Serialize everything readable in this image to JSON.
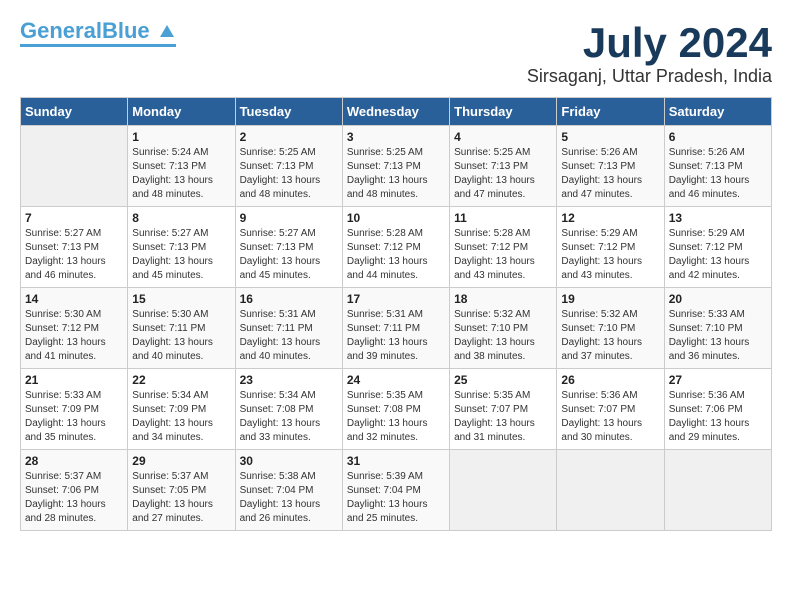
{
  "header": {
    "logo_general": "General",
    "logo_blue": "Blue",
    "month_title": "July 2024",
    "location": "Sirsaganj, Uttar Pradesh, India"
  },
  "calendar": {
    "days_of_week": [
      "Sunday",
      "Monday",
      "Tuesday",
      "Wednesday",
      "Thursday",
      "Friday",
      "Saturday"
    ],
    "weeks": [
      [
        {
          "day": "",
          "info": ""
        },
        {
          "day": "1",
          "info": "Sunrise: 5:24 AM\nSunset: 7:13 PM\nDaylight: 13 hours\nand 48 minutes."
        },
        {
          "day": "2",
          "info": "Sunrise: 5:25 AM\nSunset: 7:13 PM\nDaylight: 13 hours\nand 48 minutes."
        },
        {
          "day": "3",
          "info": "Sunrise: 5:25 AM\nSunset: 7:13 PM\nDaylight: 13 hours\nand 48 minutes."
        },
        {
          "day": "4",
          "info": "Sunrise: 5:25 AM\nSunset: 7:13 PM\nDaylight: 13 hours\nand 47 minutes."
        },
        {
          "day": "5",
          "info": "Sunrise: 5:26 AM\nSunset: 7:13 PM\nDaylight: 13 hours\nand 47 minutes."
        },
        {
          "day": "6",
          "info": "Sunrise: 5:26 AM\nSunset: 7:13 PM\nDaylight: 13 hours\nand 46 minutes."
        }
      ],
      [
        {
          "day": "7",
          "info": "Sunrise: 5:27 AM\nSunset: 7:13 PM\nDaylight: 13 hours\nand 46 minutes."
        },
        {
          "day": "8",
          "info": "Sunrise: 5:27 AM\nSunset: 7:13 PM\nDaylight: 13 hours\nand 45 minutes."
        },
        {
          "day": "9",
          "info": "Sunrise: 5:27 AM\nSunset: 7:13 PM\nDaylight: 13 hours\nand 45 minutes."
        },
        {
          "day": "10",
          "info": "Sunrise: 5:28 AM\nSunset: 7:12 PM\nDaylight: 13 hours\nand 44 minutes."
        },
        {
          "day": "11",
          "info": "Sunrise: 5:28 AM\nSunset: 7:12 PM\nDaylight: 13 hours\nand 43 minutes."
        },
        {
          "day": "12",
          "info": "Sunrise: 5:29 AM\nSunset: 7:12 PM\nDaylight: 13 hours\nand 43 minutes."
        },
        {
          "day": "13",
          "info": "Sunrise: 5:29 AM\nSunset: 7:12 PM\nDaylight: 13 hours\nand 42 minutes."
        }
      ],
      [
        {
          "day": "14",
          "info": "Sunrise: 5:30 AM\nSunset: 7:12 PM\nDaylight: 13 hours\nand 41 minutes."
        },
        {
          "day": "15",
          "info": "Sunrise: 5:30 AM\nSunset: 7:11 PM\nDaylight: 13 hours\nand 40 minutes."
        },
        {
          "day": "16",
          "info": "Sunrise: 5:31 AM\nSunset: 7:11 PM\nDaylight: 13 hours\nand 40 minutes."
        },
        {
          "day": "17",
          "info": "Sunrise: 5:31 AM\nSunset: 7:11 PM\nDaylight: 13 hours\nand 39 minutes."
        },
        {
          "day": "18",
          "info": "Sunrise: 5:32 AM\nSunset: 7:10 PM\nDaylight: 13 hours\nand 38 minutes."
        },
        {
          "day": "19",
          "info": "Sunrise: 5:32 AM\nSunset: 7:10 PM\nDaylight: 13 hours\nand 37 minutes."
        },
        {
          "day": "20",
          "info": "Sunrise: 5:33 AM\nSunset: 7:10 PM\nDaylight: 13 hours\nand 36 minutes."
        }
      ],
      [
        {
          "day": "21",
          "info": "Sunrise: 5:33 AM\nSunset: 7:09 PM\nDaylight: 13 hours\nand 35 minutes."
        },
        {
          "day": "22",
          "info": "Sunrise: 5:34 AM\nSunset: 7:09 PM\nDaylight: 13 hours\nand 34 minutes."
        },
        {
          "day": "23",
          "info": "Sunrise: 5:34 AM\nSunset: 7:08 PM\nDaylight: 13 hours\nand 33 minutes."
        },
        {
          "day": "24",
          "info": "Sunrise: 5:35 AM\nSunset: 7:08 PM\nDaylight: 13 hours\nand 32 minutes."
        },
        {
          "day": "25",
          "info": "Sunrise: 5:35 AM\nSunset: 7:07 PM\nDaylight: 13 hours\nand 31 minutes."
        },
        {
          "day": "26",
          "info": "Sunrise: 5:36 AM\nSunset: 7:07 PM\nDaylight: 13 hours\nand 30 minutes."
        },
        {
          "day": "27",
          "info": "Sunrise: 5:36 AM\nSunset: 7:06 PM\nDaylight: 13 hours\nand 29 minutes."
        }
      ],
      [
        {
          "day": "28",
          "info": "Sunrise: 5:37 AM\nSunset: 7:06 PM\nDaylight: 13 hours\nand 28 minutes."
        },
        {
          "day": "29",
          "info": "Sunrise: 5:37 AM\nSunset: 7:05 PM\nDaylight: 13 hours\nand 27 minutes."
        },
        {
          "day": "30",
          "info": "Sunrise: 5:38 AM\nSunset: 7:04 PM\nDaylight: 13 hours\nand 26 minutes."
        },
        {
          "day": "31",
          "info": "Sunrise: 5:39 AM\nSunset: 7:04 PM\nDaylight: 13 hours\nand 25 minutes."
        },
        {
          "day": "",
          "info": ""
        },
        {
          "day": "",
          "info": ""
        },
        {
          "day": "",
          "info": ""
        }
      ]
    ]
  }
}
